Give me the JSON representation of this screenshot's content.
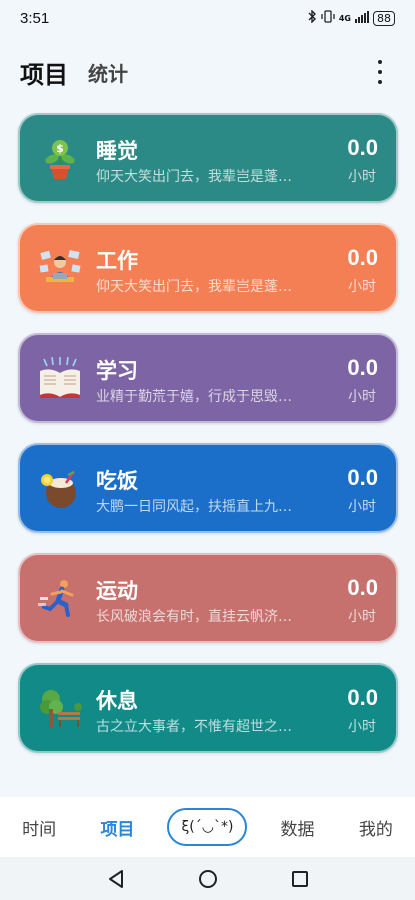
{
  "status_bar": {
    "time": "3:51",
    "network": "4G",
    "battery": "88"
  },
  "header": {
    "tab_active": "项目",
    "tab_inactive": "统计"
  },
  "cards": [
    {
      "title": "睡觉",
      "desc": "仰天大笑出门去，我辈岂是蓬…",
      "value": "0.0",
      "unit": "小时",
      "color": "#2b8a85",
      "icon": "money-plant-icon"
    },
    {
      "title": "工作",
      "desc": "仰天大笑出门去，我辈岂是蓬…",
      "value": "0.0",
      "unit": "小时",
      "color": "#f57f55",
      "icon": "office-worker-icon"
    },
    {
      "title": "学习",
      "desc": "业精于勤荒于嬉，行成于思毁…",
      "value": "0.0",
      "unit": "小时",
      "color": "#7d64a5",
      "icon": "open-book-icon"
    },
    {
      "title": "吃饭",
      "desc": "大鹏一日同风起，扶摇直上九…",
      "value": "0.0",
      "unit": "小时",
      "color": "#1c6fc9",
      "icon": "coconut-drink-icon"
    },
    {
      "title": "运动",
      "desc": "长风破浪会有时，直挂云帆济…",
      "value": "0.0",
      "unit": "小时",
      "color": "#c7716f",
      "icon": "runner-icon"
    },
    {
      "title": "休息",
      "desc": "古之立大事者，不惟有超世之…",
      "value": "0.0",
      "unit": "小时",
      "color": "#118a88",
      "icon": "tree-bench-icon"
    }
  ],
  "bottom_nav": {
    "time": "时间",
    "project": "项目",
    "center": "ξ(´◡`*)",
    "data": "数据",
    "mine": "我的"
  }
}
